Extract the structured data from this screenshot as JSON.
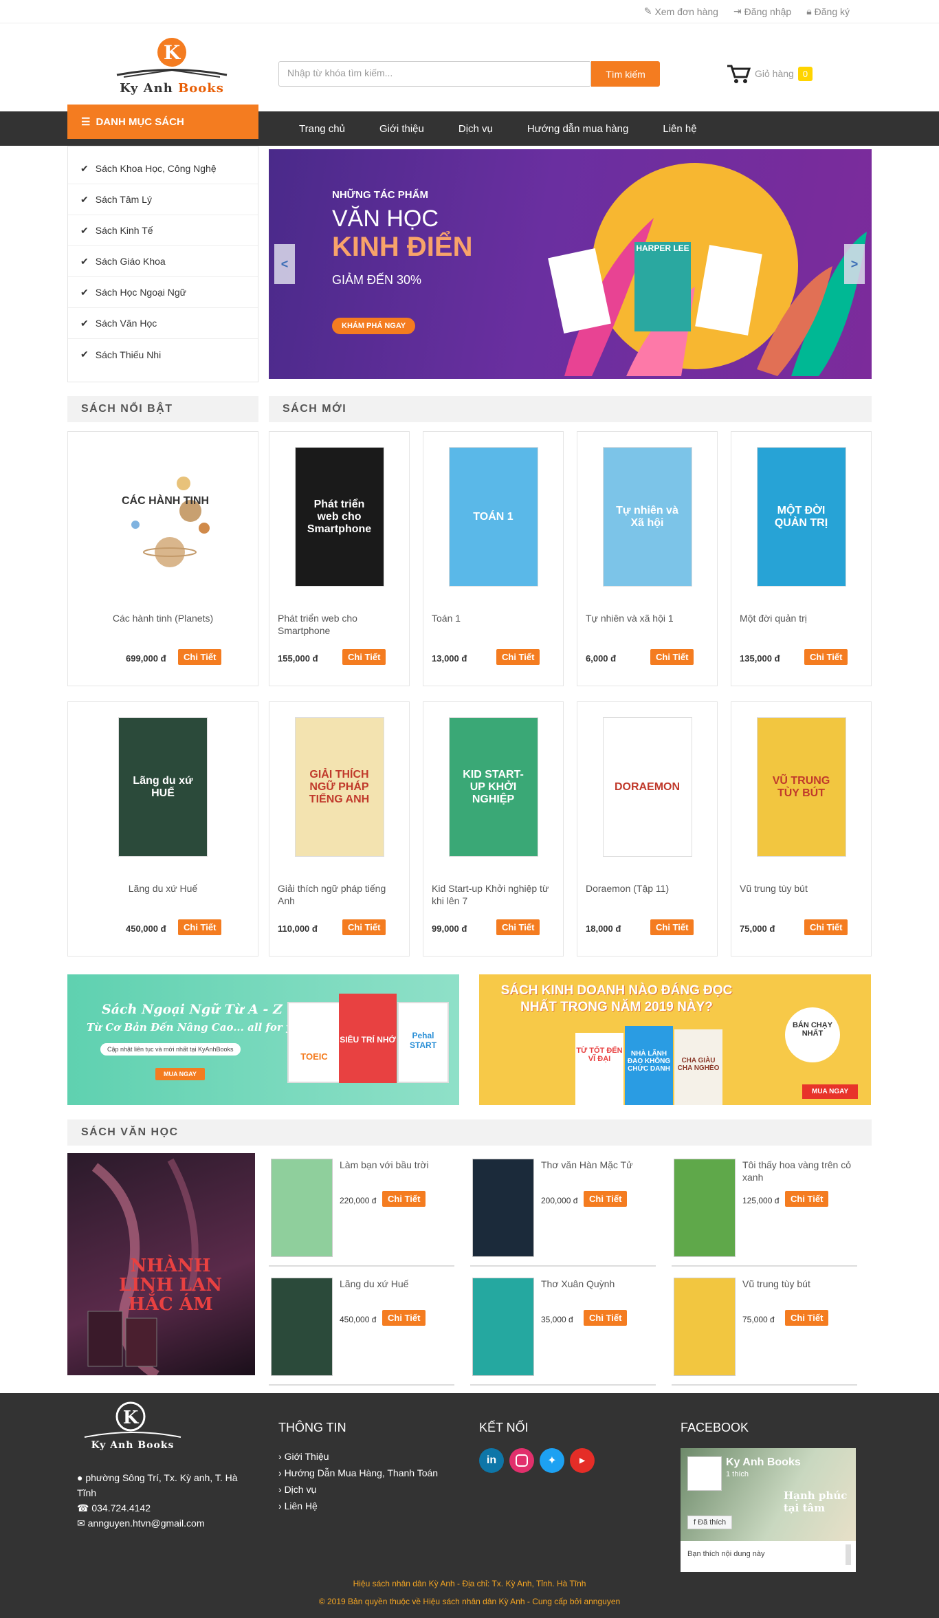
{
  "topbar": {
    "orders": "Xem đơn hàng",
    "login": "Đăng nhập",
    "register": "Đăng ký"
  },
  "header": {
    "logo_text_a": "Ky Anh",
    "logo_text_b": "Books",
    "search_placeholder": "Nhập từ khóa tìm kiếm...",
    "search_button": "Tìm kiếm",
    "cart_label": "Giỏ hàng",
    "cart_count": "0"
  },
  "nav": {
    "items": [
      "Trang chủ",
      "Giới thiệu",
      "Dịch vụ",
      "Hướng dẫn mua hàng",
      "Liên hệ"
    ]
  },
  "categories": {
    "title": "DANH MỤC SÁCH",
    "items": [
      "Sách Khoa Học, Công Nghệ",
      "Sách Tâm Lý",
      "Sách Kinh Tế",
      "Sách Giáo Khoa",
      "Sách Học Ngoại Ngữ",
      "Sách Văn Học",
      "Sách Thiếu Nhi"
    ]
  },
  "banner": {
    "line1": "NHỮNG TÁC PHẨM",
    "line2": "VĂN HỌC",
    "line3": "KINH ĐIỂN",
    "line4": "GIẢM ĐẾN 30%",
    "button": "KHÁM PHÁ NGAY",
    "book_label": "HARPER LEE",
    "prev": "<",
    "next": ">"
  },
  "featured": {
    "title": "SÁCH NỔI BẬT",
    "product": {
      "name": "Các hành tinh (Planets)",
      "price": "699,000 đ",
      "cover_text": "CÁC HÀNH TINH"
    }
  },
  "new_books": {
    "title": "SÁCH MỚI",
    "items": [
      {
        "name": "Phát triển web cho Smartphone",
        "price": "155,000 đ",
        "cover_text": "Phát triển web cho Smartphone",
        "color": "#1a1a1a"
      },
      {
        "name": "Toán 1",
        "price": "13,000 đ",
        "cover_text": "TOÁN 1",
        "color": "#5ab8e8"
      },
      {
        "name": "Tự nhiên và xã hội 1",
        "price": "6,000 đ",
        "cover_text": "Tự nhiên và Xã hội",
        "color": "#7cc4e8"
      },
      {
        "name": "Một đời quản trị",
        "price": "135,000 đ",
        "cover_text": "MỘT ĐỜI QUẢN TRỊ",
        "color": "#27a3d6"
      },
      {
        "name": "Lãng du xứ Huế",
        "price": "450,000 đ",
        "cover_text": "Lãng du xứ HUẾ",
        "color": "#2b4a3a"
      },
      {
        "name": "Giải thích ngữ pháp tiếng Anh",
        "price": "110,000 đ",
        "cover_text": "GIẢI THÍCH NGỮ PHÁP TIẾNG ANH",
        "color": "#f3e3b0"
      },
      {
        "name": "Kid Start-up Khởi nghiệp từ khi lên 7",
        "price": "99,000 đ",
        "cover_text": "KID START-UP KHỞI NGHIỆP",
        "color": "#3aa876"
      },
      {
        "name": "Doraemon (Tập 11)",
        "price": "18,000 đ",
        "cover_text": "DORAEMON",
        "color": "#ffffff"
      },
      {
        "name": "Vũ trung tùy bút",
        "price": "75,000 đ",
        "cover_text": "VŨ TRUNG TÙY BÚT",
        "color": "#f2c640"
      }
    ],
    "detail_label": "Chi Tiết"
  },
  "promos": {
    "left": {
      "title": "Sách Ngoại Ngữ Từ A - Z",
      "subtitle": "Từ Cơ Bản Đến Nâng Cao... all for you",
      "note": "Cập nhật liên tục và mới nhất tại KyAnhBooks",
      "button": "MUA NGAY",
      "book1": "SIÊU TRÍ NHỚ",
      "book2": "Pehal START",
      "book3": "TOEIC"
    },
    "right": {
      "title": "SÁCH KINH DOANH NÀO ĐÁNG ĐỌC NHẤT TRONG NĂM 2019 NÀY?",
      "badge": "BÁN CHẠY NHẤT",
      "button": "MUA NGAY",
      "book1": "TỪ TỐT ĐẾN VĨ ĐẠI",
      "book2": "NHÀ LÃNH ĐẠO KHÔNG CHỨC DANH",
      "book3": "CHA GIÀU CHA NGHÈO"
    }
  },
  "literature": {
    "title": "SÁCH VĂN HỌC",
    "feature_cover": "NHÀNH LINH LAN HẮC ÁM",
    "items": [
      {
        "name": "Làm bạn với bầu trời",
        "price": "220,000 đ",
        "color": "#8fcf9c"
      },
      {
        "name": "Thơ văn Hàn Mặc Tử",
        "price": "200,000 đ",
        "color": "#1b2a3a"
      },
      {
        "name": "Tôi thấy hoa vàng trên cỏ xanh",
        "price": "125,000 đ",
        "color": "#5fa84a"
      },
      {
        "name": "Lãng du xứ Huế",
        "price": "450,000 đ",
        "color": "#2b4a3a"
      },
      {
        "name": "Thơ Xuân Quỳnh",
        "price": "35,000 đ",
        "color": "#25a8a0"
      },
      {
        "name": "Vũ trung tùy bút",
        "price": "75,000 đ",
        "color": "#f2c640"
      }
    ]
  },
  "footer": {
    "address": "phường Sông Trí, Tx. Kỳ anh, T. Hà Tĩnh",
    "phone": "034.724.4142",
    "email": "annguyen.htvn@gmail.com",
    "info_title": "THÔNG TIN",
    "info_links": [
      "Giới Thiệu",
      "Hướng Dẫn Mua Hàng, Thanh Toán",
      "Dịch vụ",
      "Liên Hệ"
    ],
    "connect_title": "KẾT NỐI",
    "facebook_title": "FACEBOOK",
    "fb_page": "Ky Anh Books",
    "fb_likes": "1 thích",
    "fb_liked": "Đã thích",
    "fb_placeholder": "Bạn thích nội dung này",
    "fb_cover_text": "Hạnh phúc tại tâm",
    "copyright1": "Hiệu sách nhân dân Kỳ Anh - Địa chỉ: Tx. Kỳ Anh, Tỉnh. Hà Tĩnh",
    "copyright2": "© 2019 Bản quyền thuộc về Hiệu sách nhân dân Kỳ Anh - Cung cấp bởi annguyen"
  },
  "colors": {
    "accent": "#f47c20",
    "dark": "#333333",
    "cart_badge": "#ffd400"
  }
}
